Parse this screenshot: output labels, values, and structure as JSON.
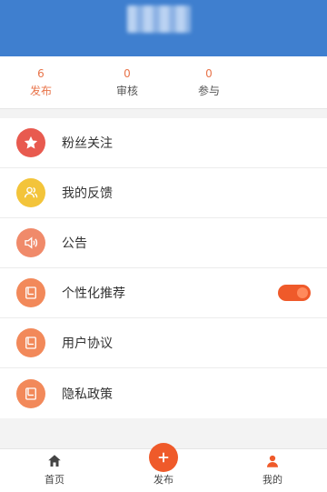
{
  "stats": [
    {
      "value": "6",
      "label": "发布"
    },
    {
      "value": "0",
      "label": "审核"
    },
    {
      "value": "0",
      "label": "参与"
    }
  ],
  "menu": [
    {
      "label": "粉丝关注",
      "icon": "star-icon",
      "icon_color": "#e85a4f"
    },
    {
      "label": "我的反馈",
      "icon": "users-icon",
      "icon_color": "#f3c43a"
    },
    {
      "label": "公告",
      "icon": "speaker-icon",
      "icon_color": "#f08a6a"
    },
    {
      "label": "个性化推荐",
      "icon": "book-icon",
      "icon_color": "#f2895a",
      "toggle_on": true
    },
    {
      "label": "用户协议",
      "icon": "book-icon",
      "icon_color": "#f2895a"
    },
    {
      "label": "隐私政策",
      "icon": "book-icon",
      "icon_color": "#f2895a"
    }
  ],
  "bottom_nav": [
    {
      "label": "首页",
      "icon": "home-icon"
    },
    {
      "label": "发布",
      "icon": "plus-icon"
    },
    {
      "label": "我的",
      "icon": "user-icon"
    }
  ],
  "colors": {
    "header_bg": "#3f7fcf",
    "accent": "#ef5a2a"
  }
}
